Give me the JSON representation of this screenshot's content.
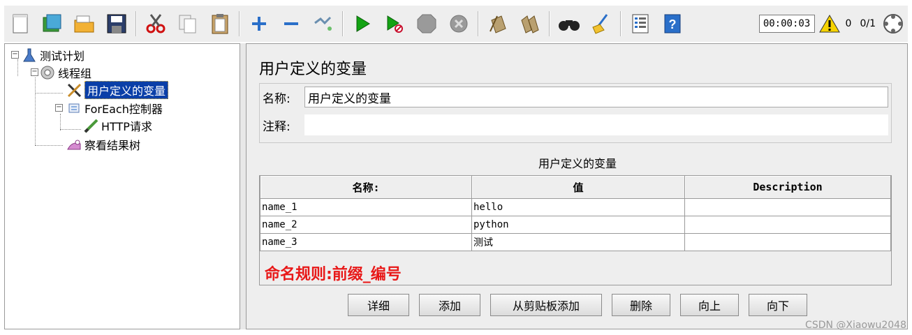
{
  "toolbar": {
    "icons": [
      "new-icon",
      "templates-icon",
      "open-icon",
      "save-icon",
      "cut-icon",
      "copy-icon",
      "paste-icon",
      "expand-icon",
      "collapse-icon",
      "toggle-icon",
      "start-icon",
      "start-no-pause-icon",
      "stop-icon",
      "shutdown-icon",
      "clear-icon",
      "clear-all-icon",
      "search-icon",
      "reset-search-icon",
      "function-helper-icon",
      "help-icon"
    ],
    "timer": "00:00:03",
    "warning_count": "0",
    "threads": "0/1"
  },
  "tree": {
    "items": [
      {
        "label": "测试计划",
        "icon": "test-plan-icon"
      },
      {
        "label": "线程组",
        "icon": "thread-group-icon"
      },
      {
        "label": "用户定义的变量",
        "icon": "config-element-icon"
      },
      {
        "label": "ForEach控制器",
        "icon": "foreach-controller-icon"
      },
      {
        "label": "HTTP请求",
        "icon": "http-sampler-icon"
      },
      {
        "label": "察看结果树",
        "icon": "listener-icon"
      }
    ]
  },
  "panel": {
    "title": "用户定义的变量",
    "name_label": "名称:",
    "name_value": "用户定义的变量",
    "comment_label": "注释:",
    "comment_value": "",
    "table_caption": "用户定义的变量",
    "columns": [
      "名称:",
      "值",
      "Description"
    ],
    "rows": [
      [
        "name_1",
        "hello",
        ""
      ],
      [
        "name_2",
        "python",
        ""
      ],
      [
        "name_3",
        "测试",
        ""
      ]
    ],
    "rule_note": "命名规则:前缀_编号",
    "buttons": [
      "详细",
      "添加",
      "从剪贴板添加",
      "删除",
      "向上",
      "向下"
    ]
  },
  "watermark": "CSDN @Xiaowu2048",
  "colors": {
    "selection": "#0a3fa8",
    "rule_note": "#e81818"
  }
}
